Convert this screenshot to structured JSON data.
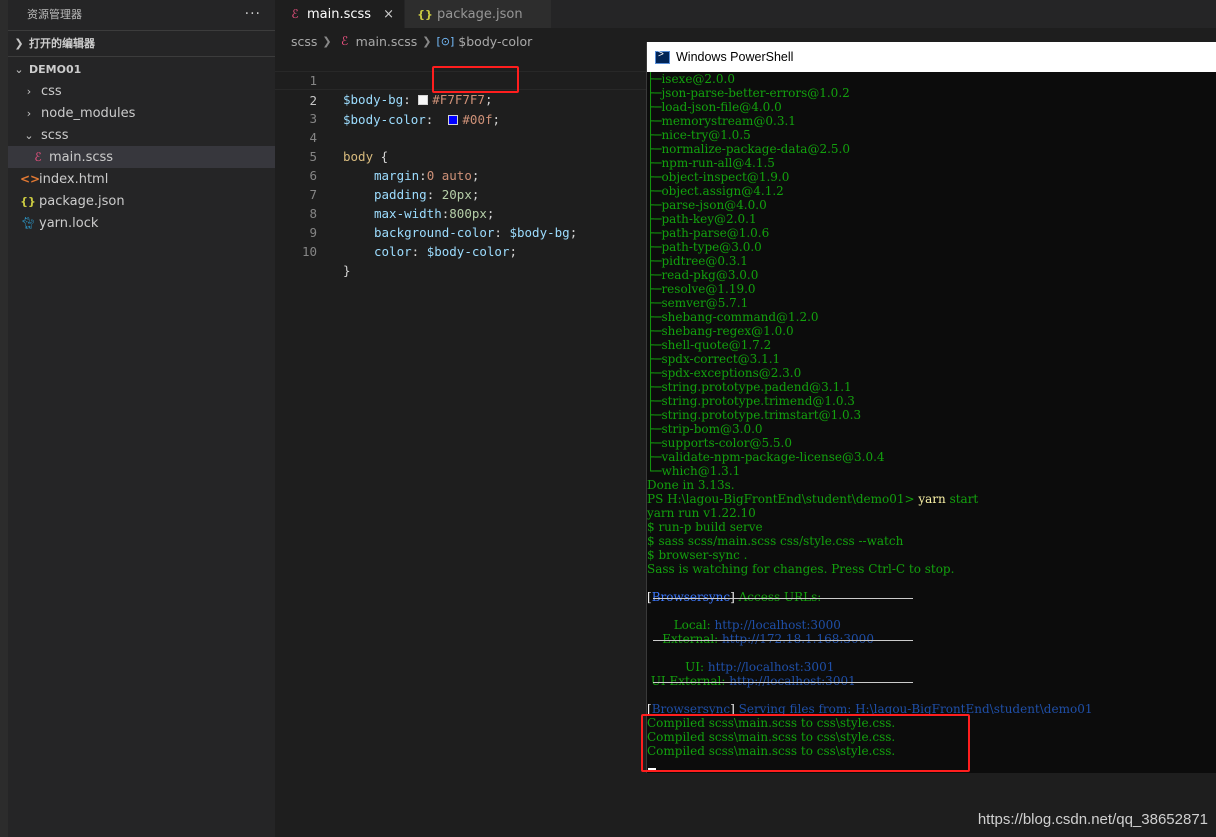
{
  "explorer": {
    "title": "资源管理器",
    "more_icon": "ellipsis-icon",
    "open_editors_label": "打开的编辑器",
    "folder_label": "DEMO01",
    "tree": [
      {
        "label": "css",
        "kind": "folder",
        "expanded": false
      },
      {
        "label": "node_modules",
        "kind": "folder",
        "expanded": false
      },
      {
        "label": "scss",
        "kind": "folder",
        "expanded": true
      },
      {
        "label": "main.scss",
        "kind": "sass-file",
        "active": true
      },
      {
        "label": "index.html",
        "kind": "html-file"
      },
      {
        "label": "package.json",
        "kind": "json-file"
      },
      {
        "label": "yarn.lock",
        "kind": "yarn-file"
      }
    ]
  },
  "tabs": [
    {
      "label": "main.scss",
      "active": true,
      "close": "×"
    },
    {
      "label": "package.json",
      "active": false
    }
  ],
  "breadcrumb": {
    "folder": "scss",
    "file": "main.scss",
    "symbol": "$body-color"
  },
  "editor": {
    "line_numbers": [
      "1",
      "2",
      "3",
      "4",
      "5",
      "6",
      "7",
      "8",
      "9",
      "10"
    ],
    "l1": {
      "var": "$body-bg",
      "colon": ":",
      "value": "#F7F7F7",
      "semi": ";",
      "swatch": "#f7f7f7"
    },
    "l2": {
      "var": "$body-color",
      "colon": ":",
      "value": "#00f",
      "semi": ";",
      "swatch": "#0000ff"
    },
    "l4": {
      "selector": "body",
      "brace": " {"
    },
    "l5": {
      "prop": "margin",
      "sep": ":",
      "value": "0 auto",
      "semi": ";"
    },
    "l6": {
      "prop": "padding",
      "sep": ": ",
      "value": "20px",
      "semi": ";"
    },
    "l7": {
      "prop": "max-width",
      "sep": ":",
      "value": "800px",
      "semi": ";"
    },
    "l8": {
      "prop": "background-color",
      "sep": ": ",
      "value": "$body-bg",
      "semi": ";"
    },
    "l9": {
      "prop": "color",
      "sep": ": ",
      "value": "$body-color",
      "semi": ";"
    },
    "l10": {
      "brace": "}"
    }
  },
  "powershell": {
    "title": "Windows PowerShell",
    "deps": [
      "├─isexe@2.0.0",
      "├─json-parse-better-errors@1.0.2",
      "├─load-json-file@4.0.0",
      "├─memorystream@0.3.1",
      "├─nice-try@1.0.5",
      "├─normalize-package-data@2.5.0",
      "├─npm-run-all@4.1.5",
      "├─object-inspect@1.9.0",
      "├─object.assign@4.1.2",
      "├─parse-json@4.0.0",
      "├─path-key@2.0.1",
      "├─path-parse@1.0.6",
      "├─path-type@3.0.0",
      "├─pidtree@0.3.1",
      "├─read-pkg@3.0.0",
      "├─resolve@1.19.0",
      "├─semver@5.7.1",
      "├─shebang-command@1.2.0",
      "├─shebang-regex@1.0.0",
      "├─shell-quote@1.7.2",
      "├─spdx-correct@3.1.1",
      "├─spdx-exceptions@2.3.0",
      "├─string.prototype.padend@3.1.1",
      "├─string.prototype.trimend@1.0.3",
      "├─string.prototype.trimstart@1.0.3",
      "├─strip-bom@3.0.0",
      "├─supports-color@5.5.0",
      "├─validate-npm-package-license@3.0.4",
      "└─which@1.3.1"
    ],
    "done": "Done in 3.13s.",
    "prompt": "PS H:\\lagou-BigFrontEnd\\student\\demo01> ",
    "cmd_yarn": "yarn",
    "cmd_args": " start",
    "run_lines": [
      "yarn run v1.22.10",
      "$ run-p build serve",
      "$ sass scss/main.scss css/style.css --watch",
      "$ browser-sync .",
      "Sass is watching for changes. Press Ctrl-C to stop."
    ],
    "bs_tag_open": "[",
    "bs_tag": "Browsersync",
    "bs_tag_close": "]",
    "bs_access": " Access URLs:",
    "local_label": "       Local: ",
    "local_url": "http://localhost:3000",
    "external_label": "    External: ",
    "external_url": "http://172.18.1.168:3000",
    "ui_label": "          UI: ",
    "ui_url": "http://localhost:3001",
    "ui_external_label": " UI External: ",
    "ui_external_url": "http://localhost:3001",
    "serving_label": " Serving files from: ",
    "serving_path": "H:\\lagou-BigFrontEnd\\student\\demo01",
    "compiled": [
      "Compiled scss\\main.scss to css\\style.css.",
      "Compiled scss\\main.scss to css\\style.css.",
      "Compiled scss\\main.scss to css\\style.css."
    ]
  },
  "watermark": "https://blog.csdn.net/qq_38652871",
  "colors": {
    "highlight_box": "#ff1e1e",
    "terminal_green": "#13a10e",
    "link_blue": "#3b78ff"
  }
}
